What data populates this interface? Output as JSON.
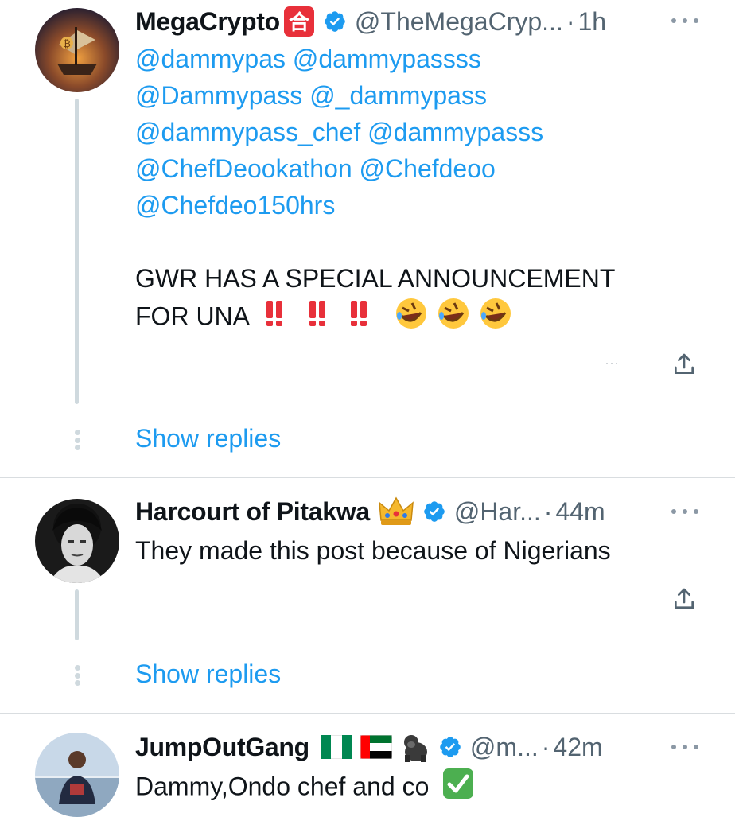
{
  "tweets": [
    {
      "name": "MegaCrypto",
      "name_badge_glyph": "合",
      "handle": "@TheMegaCryp...",
      "separator": "·",
      "time": "1h",
      "mention_lines": [
        "@dammypas @dammypassss",
        "@Dammypass @_dammypass",
        "@dammypass_chef @dammypasss",
        "@ChefDeookathon @Chefdeoo",
        "@Chefdeo150hrs"
      ],
      "text_lines": [
        "GWR HAS A SPECIAL ANNOUNCEMENT",
        "FOR UNA"
      ],
      "trailing_emojis": "‼️ ‼️ ‼️ 🤣🤣🤣",
      "show_replies": "Show replies"
    },
    {
      "name": "Harcourt of Pitakwa",
      "handle": "@Har...",
      "separator": "·",
      "time": "44m",
      "text": "They made this post because of Nigerians",
      "show_replies": "Show replies"
    },
    {
      "name": "JumpOutGang",
      "handle": "@m...",
      "separator": "·",
      "time": "42m",
      "text": "Dammy,Ondo chef and co"
    }
  ],
  "colors": {
    "link": "#1d9bf0",
    "secondary": "#536471",
    "verified": "#1d9bf0",
    "thread_line": "#cfd9de"
  },
  "icons": [
    "verified-badge-icon",
    "more-options-icon",
    "share-icon",
    "crown-emoji",
    "nigeria-flag",
    "uae-flag",
    "gorilla-emoji",
    "check-mark-emoji",
    "double-exclamation-emoji",
    "rolling-laughing-emoji"
  ]
}
